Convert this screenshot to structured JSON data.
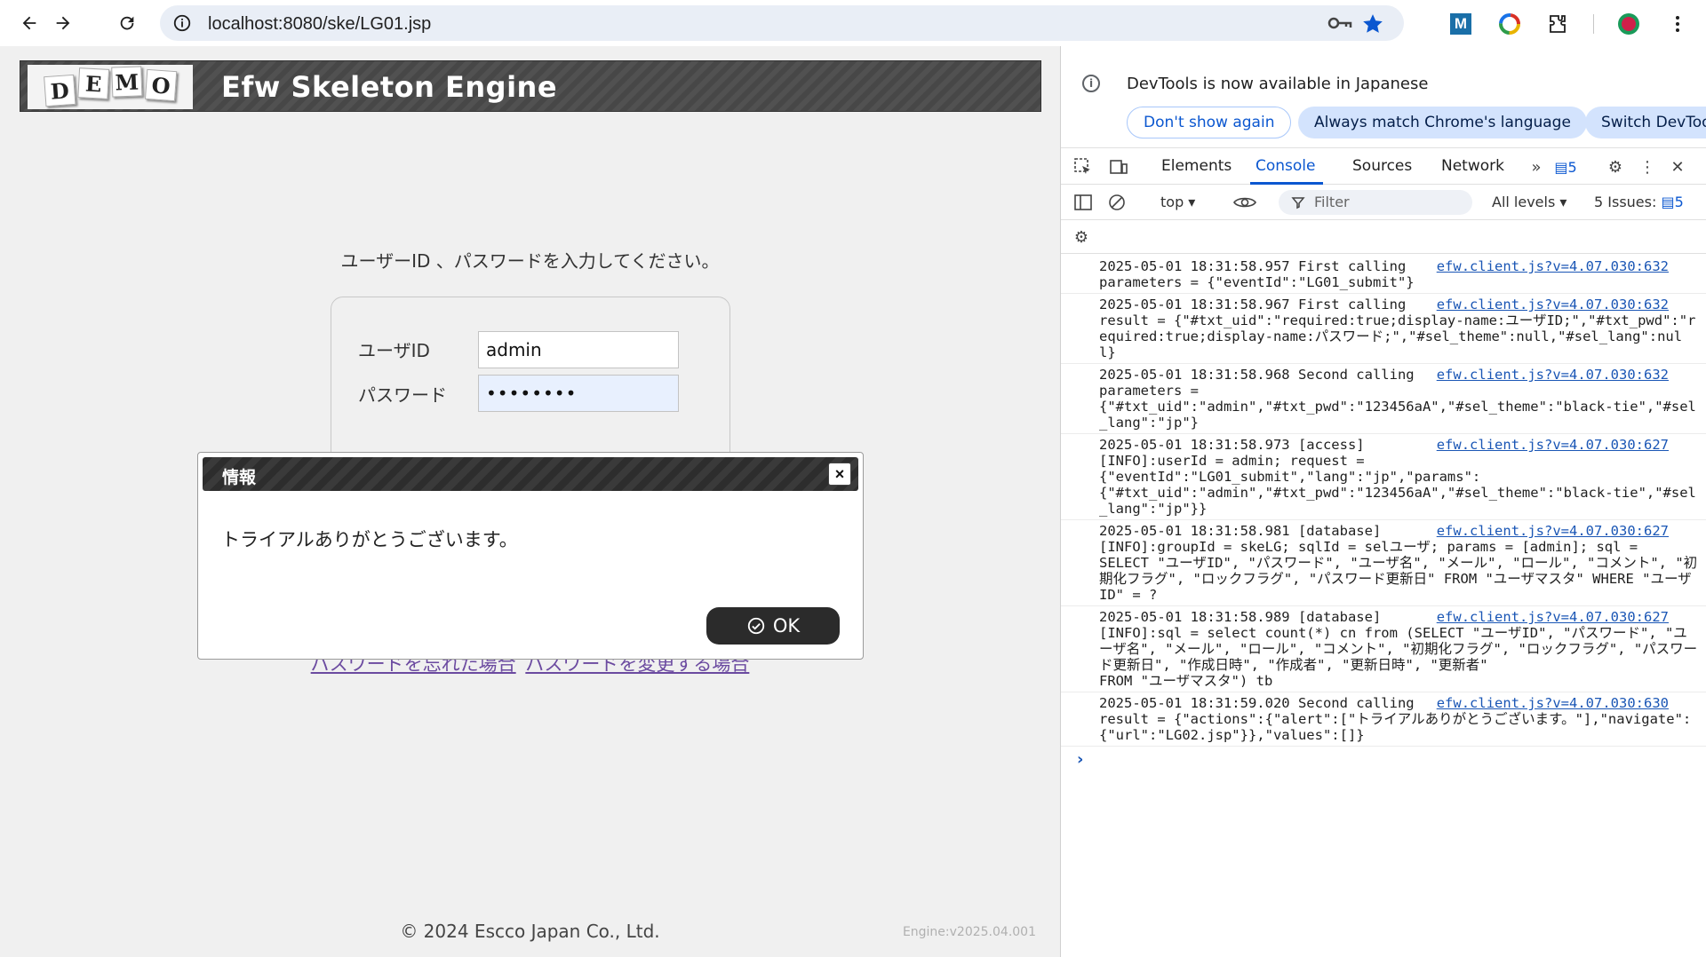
{
  "browser": {
    "url": "localhost:8080/ske/LG01.jsp"
  },
  "page": {
    "logo_letters": [
      "D",
      "E",
      "M",
      "O"
    ],
    "app_title": "Efw Skeleton Engine",
    "prompt": "ユーザーID 、パスワードを入力してください。",
    "user_id_label": "ユーザID",
    "user_id_value": "admin",
    "password_label": "パスワード",
    "password_value": "••••••••",
    "link_forgot": "パスワードを忘れた場合",
    "link_change": "パスワードを変更する場合",
    "copyright": "© 2024 Escco Japan Co., Ltd.",
    "engine_version": "Engine:v2025.04.001"
  },
  "modal": {
    "title": "情報",
    "close": "×",
    "message": "トライアルありがとうございます。",
    "ok_label": "OK"
  },
  "devtools": {
    "banner_message": "DevTools is now available in Japanese",
    "btn_dont_show": "Don't show again",
    "btn_match_lang": "Always match Chrome's language",
    "btn_switch": "Switch DevToo",
    "tabs": [
      "Elements",
      "Console",
      "Sources",
      "Network"
    ],
    "message_count": "5",
    "context": "top",
    "filter_placeholder": "Filter",
    "levels": "All levels",
    "issues_label": "5 Issues:",
    "issues_count": "5",
    "logs": [
      {
        "src": "efw.client.js?v=4.07.030:632",
        "text": "2025-05-01 18:31:58.957 First calling\nparameters = {\"eventId\":\"LG01_submit\"}"
      },
      {
        "src": "efw.client.js?v=4.07.030:632",
        "text": "2025-05-01 18:31:58.967 First calling\nresult = {\"#txt_uid\":\"required:true;display-name:ユーザID;\",\"#txt_pwd\":\"required:true;display-name:パスワード;\",\"#sel_theme\":null,\"#sel_lang\":null}"
      },
      {
        "src": "efw.client.js?v=4.07.030:632",
        "text": "2025-05-01 18:31:58.968 Second calling\nparameters =\n{\"#txt_uid\":\"admin\",\"#txt_pwd\":\"123456aA\",\"#sel_theme\":\"black-tie\",\"#sel_lang\":\"jp\"}"
      },
      {
        "src": "efw.client.js?v=4.07.030:627",
        "text": "2025-05-01 18:31:58.973 [access]\n[INFO]:userId = admin; request =\n{\"eventId\":\"LG01_submit\",\"lang\":\"jp\",\"params\":\n{\"#txt_uid\":\"admin\",\"#txt_pwd\":\"123456aA\",\"#sel_theme\":\"black-tie\",\"#sel_lang\":\"jp\"}}"
      },
      {
        "src": "efw.client.js?v=4.07.030:627",
        "text": "2025-05-01 18:31:58.981 [database]\n[INFO]:groupId = skeLG; sqlId = selユーザ; params = [admin]; sql =\nSELECT \"ユーザID\", \"パスワード\", \"ユーザ名\", \"メール\", \"ロール\", \"コメント\", \"初期化フラグ\", \"ロックフラグ\", \"パスワード更新日\" FROM \"ユーザマスタ\" WHERE \"ユーザID\" = ?"
      },
      {
        "src": "efw.client.js?v=4.07.030:627",
        "text": "2025-05-01 18:31:58.989 [database]\n[INFO]:sql = select count(*) cn from (SELECT \"ユーザID\", \"パスワード\", \"ユーザ名\", \"メール\", \"ロール\", \"コメント\", \"初期化フラグ\", \"ロックフラグ\", \"パスワード更新日\", \"作成日時\", \"作成者\", \"更新日時\", \"更新者\"\nFROM \"ユーザマスタ\") tb"
      },
      {
        "src": "efw.client.js?v=4.07.030:630",
        "text": "2025-05-01 18:31:59.020 Second calling\nresult = {\"actions\":{\"alert\":[\"トライアルありがとうございます。\"],\"navigate\":{\"url\":\"LG02.jsp\"}},\"values\":[]}"
      }
    ]
  }
}
